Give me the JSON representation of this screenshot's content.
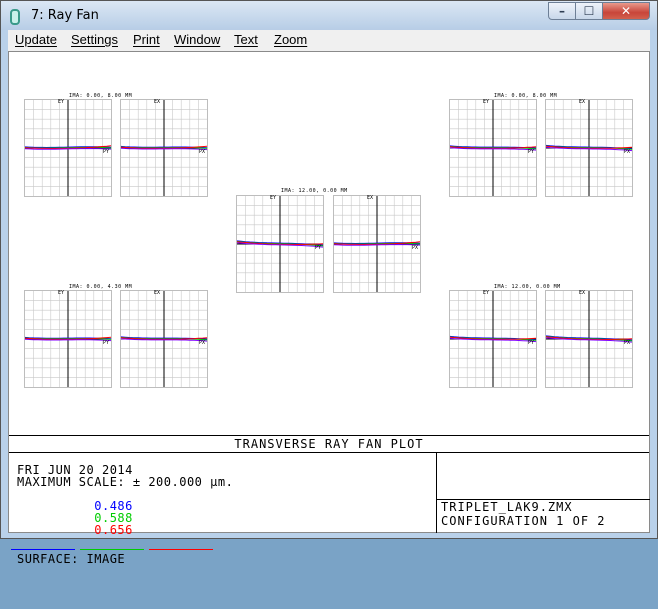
{
  "window": {
    "title": "7: Ray Fan",
    "minimize": "–",
    "maximize": "☐",
    "close": "✕"
  },
  "menu": {
    "items": [
      {
        "label": "Update"
      },
      {
        "label": "Settings"
      },
      {
        "label": "Print"
      },
      {
        "label": "Window"
      },
      {
        "label": "Text"
      },
      {
        "label": "Zoom"
      }
    ]
  },
  "plot": {
    "fields": [
      {
        "label": "IMA: 0.00, 8.00 MM"
      },
      {
        "label": "IMA: 0.00, 8.00 MM"
      },
      {
        "label": "IMA: 12.00, 0.00 MM"
      },
      {
        "label": "IMA: 0.00, 4.30 MM"
      },
      {
        "label": "IMA: 12.00, 0.00 MM"
      }
    ],
    "axis": {
      "ey": "EY",
      "ex": "EX",
      "py": "PY",
      "px": "PX"
    },
    "colors": {
      "blue": "#0000ff",
      "green": "#00cc00",
      "red": "#ff0000",
      "purple": "#8000ff"
    }
  },
  "footer": {
    "title": "TRANSVERSE RAY FAN PLOT",
    "date": "FRI JUN 20 2014",
    "scale": "MAXIMUM SCALE: ± 200.000 μm.",
    "wavelengths": [
      "0.486",
      "0.588",
      "0.656"
    ],
    "surface": "SURFACE: IMAGE",
    "file": "TRIPLET_LAK9.ZMX",
    "config": "CONFIGURATION 1 OF 2"
  }
}
